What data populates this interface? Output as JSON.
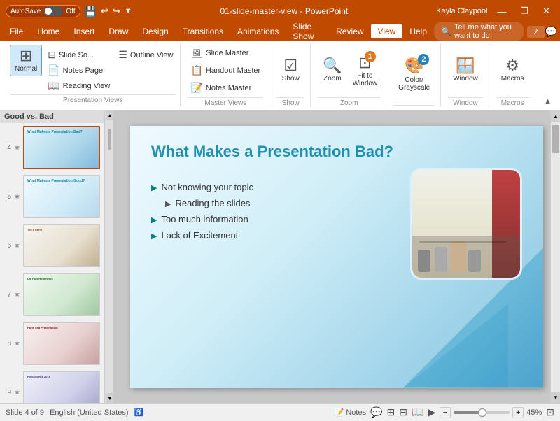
{
  "titlebar": {
    "autosave_label": "AutoSave",
    "autosave_state": "Off",
    "file_title": "01-slide-master-view - PowerPoint",
    "user_name": "Kayla Claypool",
    "undo_icon": "↩",
    "redo_icon": "↪",
    "save_icon": "💾",
    "minimize_icon": "—",
    "restore_icon": "❐",
    "close_icon": "✕"
  },
  "menubar": {
    "items": [
      "File",
      "Home",
      "Insert",
      "Draw",
      "Design",
      "Transitions",
      "Animations",
      "Slide Show",
      "Review",
      "View",
      "Help"
    ]
  },
  "ribbon": {
    "active_tab": "View",
    "tabs": [
      "File",
      "Home",
      "Insert",
      "Draw",
      "Design",
      "Transitions",
      "Animations",
      "Slide Show",
      "Review",
      "View",
      "Help"
    ],
    "tell_me_placeholder": "Tell me what you want to do",
    "groups": {
      "presentation_views": {
        "label": "Presentation Views",
        "normal_label": "Normal",
        "outline_label": "Outline\nView",
        "slide_sorter_label": "Slide So...",
        "notes_page_label": "Notes Page",
        "reading_view_label": "Reading View"
      },
      "master_views": {
        "label": "Master Views",
        "slide_master_label": "Slide Master",
        "handout_master_label": "Handout Master",
        "notes_master_label": "Notes Master"
      },
      "show": {
        "label": "Show",
        "show_label": "Show"
      },
      "zoom": {
        "label": "Zoom",
        "zoom_label": "Zoom",
        "fit_to_label": "Fit to\nWindow"
      },
      "color": {
        "label": "",
        "color_grayscale_label": "Color/\nGrayscale"
      },
      "window": {
        "label": "Window",
        "window_label": "Window"
      },
      "macros": {
        "label": "Macros",
        "macros_label": "Macros"
      }
    },
    "badge1": "1",
    "badge2": "2"
  },
  "slide_panel": {
    "header": "Good vs. Bad",
    "slides": [
      {
        "num": "4",
        "star": "★"
      },
      {
        "num": "5",
        "star": "★"
      },
      {
        "num": "6",
        "star": "★"
      },
      {
        "num": "7",
        "star": "★"
      },
      {
        "num": "8",
        "star": "★"
      },
      {
        "num": "9",
        "star": "★"
      }
    ]
  },
  "slide": {
    "title": "What Makes a Presentation Bad?",
    "bullet1": "Not knowing your topic",
    "sub_bullet1": "Reading the slides",
    "bullet2": "Too much information",
    "bullet3": "Lack of Excitement"
  },
  "statusbar": {
    "notes_label": "Notes",
    "zoom_percent": "45%",
    "zoom_minus": "−",
    "zoom_plus": "+",
    "fit_icon": "⊡"
  }
}
